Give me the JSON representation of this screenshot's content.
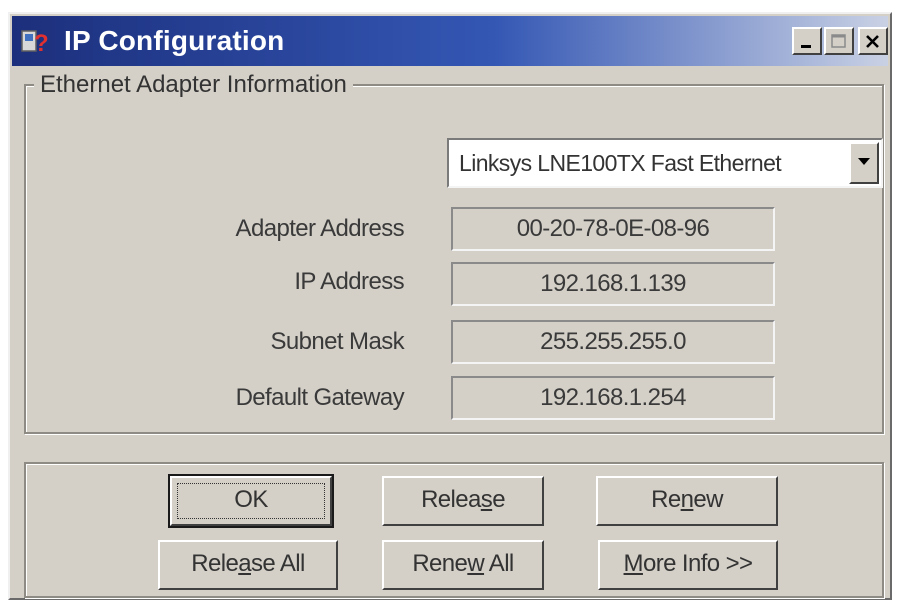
{
  "window": {
    "title": "IP Configuration"
  },
  "group": {
    "legend": "Ethernet  Adapter Information"
  },
  "adapter_select": {
    "selected": "Linksys LNE100TX Fast Ethernet"
  },
  "fields": [
    {
      "label": "Adapter Address",
      "value": "00-20-78-0E-08-96"
    },
    {
      "label": "IP Address",
      "value": "192.168.1.139"
    },
    {
      "label": "Subnet Mask",
      "value": "255.255.255.0"
    },
    {
      "label": "Default Gateway",
      "value": "192.168.1.254"
    }
  ],
  "buttons": {
    "ok": "OK",
    "release_pre": "Relea",
    "release_u": "s",
    "release_post": "e",
    "renew_pre": "Re",
    "renew_u": "n",
    "renew_post": "ew",
    "release_all_pre": "Rele",
    "release_all_u": "a",
    "release_all_post": "se All",
    "renew_all_pre": "Rene",
    "renew_all_u": "w",
    "renew_all_post": " All",
    "more_info_u": "M",
    "more_info_post": "ore Info >>"
  },
  "colors": {
    "title_start": "#1c2f7c",
    "title_end": "#c9d1e4",
    "face": "#d4d0c8"
  },
  "icons": [
    "app-icon",
    "minimize-icon",
    "maximize-icon",
    "close-icon",
    "dropdown-arrow-icon"
  ]
}
